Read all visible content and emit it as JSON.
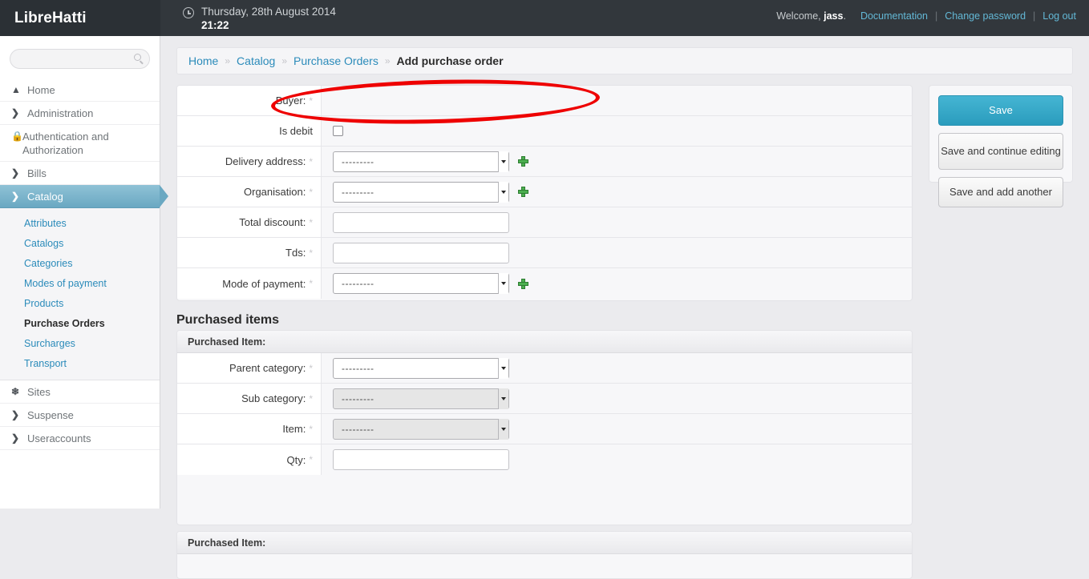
{
  "brand": {
    "title": "LibreHatti"
  },
  "header": {
    "clock_icon": "clock-icon",
    "date": "Thursday, 28th August 2014",
    "time": "21:22",
    "welcome_prefix": "Welcome, ",
    "welcome_user": "jass",
    "welcome_suffix": ".",
    "links": [
      {
        "label": "Documentation"
      },
      {
        "label": "Change password"
      },
      {
        "label": "Log out"
      }
    ],
    "separator": "|"
  },
  "sidebar": {
    "search_placeholder": "",
    "search_value": "",
    "search_icon": "search-icon",
    "items": [
      {
        "label": "Home",
        "icon": "home-icon",
        "active": false
      },
      {
        "label": "Administration",
        "icon": "chevron-right-icon",
        "active": false
      },
      {
        "label": "Authentication and Authorization",
        "icon": "lock-icon",
        "active": false
      },
      {
        "label": "Bills",
        "icon": "chevron-right-icon",
        "active": false
      },
      {
        "label": "Catalog",
        "icon": "chevron-right-icon",
        "active": true
      }
    ],
    "subitems": [
      {
        "label": "Attributes",
        "current": false
      },
      {
        "label": "Catalogs",
        "current": false
      },
      {
        "label": "Categories",
        "current": false
      },
      {
        "label": "Modes of payment",
        "current": false
      },
      {
        "label": "Products",
        "current": false
      },
      {
        "label": "Purchase Orders",
        "current": true
      },
      {
        "label": "Surcharges",
        "current": false
      },
      {
        "label": "Transport",
        "current": false
      }
    ],
    "items_after": [
      {
        "label": "Sites",
        "icon": "leaf-icon",
        "active": false
      },
      {
        "label": "Suspense",
        "icon": "chevron-right-icon",
        "active": false
      },
      {
        "label": "Useraccounts",
        "icon": "chevron-right-icon",
        "active": false
      }
    ]
  },
  "breadcrumb": {
    "separator": "»",
    "items": [
      {
        "label": "Home",
        "link": true
      },
      {
        "label": "Catalog",
        "link": true
      },
      {
        "label": "Purchase Orders",
        "link": true
      },
      {
        "label": "Add purchase order",
        "link": false
      }
    ]
  },
  "form": {
    "rows": [
      {
        "label": "Buyer:",
        "required": true,
        "control": "none",
        "value": ""
      },
      {
        "label": "Is debit",
        "required": false,
        "control": "checkbox",
        "checked": false
      },
      {
        "label": "Delivery address:",
        "required": true,
        "control": "select",
        "value": "---------",
        "add": true
      },
      {
        "label": "Organisation:",
        "required": true,
        "control": "select",
        "value": "---------",
        "add": true
      },
      {
        "label": "Total discount:",
        "required": true,
        "control": "text",
        "value": ""
      },
      {
        "label": "Tds:",
        "required": true,
        "control": "text",
        "value": ""
      },
      {
        "label": "Mode of payment:",
        "required": true,
        "control": "select",
        "value": "---------",
        "add": true
      }
    ]
  },
  "purchased_items": {
    "heading": "Purchased items",
    "group_label": "Purchased Item:",
    "rows": [
      {
        "label": "Parent category:",
        "required": true,
        "control": "select",
        "value": "---------",
        "disabled": false
      },
      {
        "label": "Sub category:",
        "required": true,
        "control": "select",
        "value": "---------",
        "disabled": true
      },
      {
        "label": "Item:",
        "required": true,
        "control": "select",
        "value": "---------",
        "disabled": true
      },
      {
        "label": "Qty:",
        "required": true,
        "control": "text",
        "value": ""
      }
    ]
  },
  "actions": {
    "save": "Save",
    "save_continue": "Save and continue editing",
    "save_add_another": "Save and add another"
  },
  "annotation": {
    "shape": "ellipse",
    "color": "#ee0000",
    "targets": "buyer-field-row"
  },
  "colors": {
    "topbar": "#32373c",
    "brand_bg": "#2b3035",
    "accent": "#2a9cbd",
    "link": "#2b8bba",
    "active_nav": "#6aa8c2",
    "page_bg": "#ebebee",
    "annotation": "#ee0000"
  }
}
